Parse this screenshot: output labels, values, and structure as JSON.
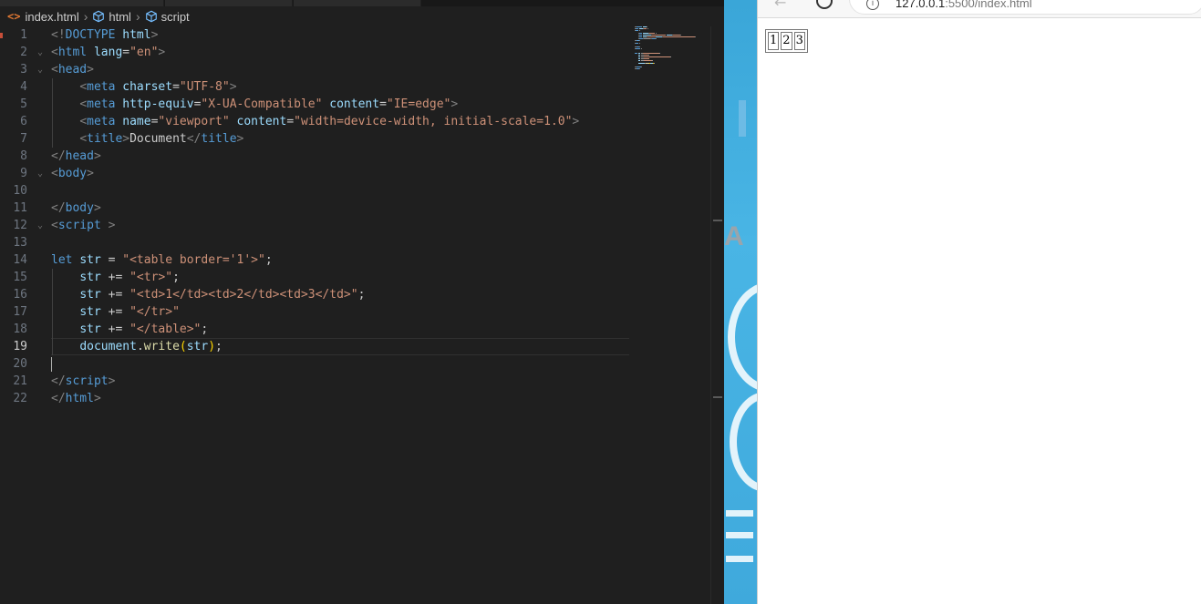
{
  "editor": {
    "breadcrumb": [
      {
        "label": "index.html",
        "icon": "html-file-icon"
      },
      {
        "label": "html",
        "icon": "symbol-element-icon"
      },
      {
        "label": "script",
        "icon": "symbol-element-icon"
      }
    ],
    "line_numbers": [
      "1",
      "2",
      "3",
      "4",
      "5",
      "6",
      "7",
      "8",
      "9",
      "10",
      "11",
      "12",
      "13",
      "14",
      "15",
      "16",
      "17",
      "18",
      "19",
      "20",
      "21",
      "22"
    ],
    "active_line": "19",
    "lines": [
      [
        [
          "p",
          "<!"
        ],
        [
          "t",
          "DOCTYPE"
        ],
        [
          "k",
          " "
        ],
        [
          "a",
          "html"
        ],
        [
          "p",
          ">"
        ]
      ],
      [
        [
          "p",
          "<"
        ],
        [
          "t",
          "html"
        ],
        [
          "k",
          " "
        ],
        [
          "a",
          "lang"
        ],
        [
          "k",
          "="
        ],
        [
          "s",
          "\"en\""
        ],
        [
          "p",
          ">"
        ]
      ],
      [
        [
          "p",
          "<"
        ],
        [
          "t",
          "head"
        ],
        [
          "p",
          ">"
        ]
      ],
      [
        [
          "k",
          "    "
        ],
        [
          "p",
          "<"
        ],
        [
          "t",
          "meta"
        ],
        [
          "k",
          " "
        ],
        [
          "a",
          "charset"
        ],
        [
          "k",
          "="
        ],
        [
          "s",
          "\"UTF-8\""
        ],
        [
          "p",
          ">"
        ]
      ],
      [
        [
          "k",
          "    "
        ],
        [
          "p",
          "<"
        ],
        [
          "t",
          "meta"
        ],
        [
          "k",
          " "
        ],
        [
          "a",
          "http-equiv"
        ],
        [
          "k",
          "="
        ],
        [
          "s",
          "\"X-UA-Compatible\""
        ],
        [
          "k",
          " "
        ],
        [
          "a",
          "content"
        ],
        [
          "k",
          "="
        ],
        [
          "s",
          "\"IE=edge\""
        ],
        [
          "p",
          ">"
        ]
      ],
      [
        [
          "k",
          "    "
        ],
        [
          "p",
          "<"
        ],
        [
          "t",
          "meta"
        ],
        [
          "k",
          " "
        ],
        [
          "a",
          "name"
        ],
        [
          "k",
          "="
        ],
        [
          "s",
          "\"viewport\""
        ],
        [
          "k",
          " "
        ],
        [
          "a",
          "content"
        ],
        [
          "k",
          "="
        ],
        [
          "s",
          "\"width=device-width, initial-scale=1.0\""
        ],
        [
          "p",
          ">"
        ]
      ],
      [
        [
          "k",
          "    "
        ],
        [
          "p",
          "<"
        ],
        [
          "t",
          "title"
        ],
        [
          "p",
          ">"
        ],
        [
          "k",
          "Document"
        ],
        [
          "p",
          "</"
        ],
        [
          "t",
          "title"
        ],
        [
          "p",
          ">"
        ]
      ],
      [
        [
          "p",
          "</"
        ],
        [
          "t",
          "head"
        ],
        [
          "p",
          ">"
        ]
      ],
      [
        [
          "p",
          "<"
        ],
        [
          "t",
          "body"
        ],
        [
          "p",
          ">"
        ]
      ],
      [],
      [
        [
          "p",
          "</"
        ],
        [
          "t",
          "body"
        ],
        [
          "p",
          ">"
        ]
      ],
      [
        [
          "p",
          "<"
        ],
        [
          "t",
          "script"
        ],
        [
          "k",
          " "
        ],
        [
          "p",
          ">"
        ]
      ],
      [],
      [
        [
          "w",
          "let"
        ],
        [
          "k",
          " "
        ],
        [
          "v",
          "str"
        ],
        [
          "k",
          " = "
        ],
        [
          "s",
          "\"<table border='1'>\""
        ],
        [
          "k",
          ";"
        ]
      ],
      [
        [
          "k",
          "    "
        ],
        [
          "v",
          "str"
        ],
        [
          "k",
          " += "
        ],
        [
          "s",
          "\"<tr>\""
        ],
        [
          "k",
          ";"
        ]
      ],
      [
        [
          "k",
          "    "
        ],
        [
          "v",
          "str"
        ],
        [
          "k",
          " += "
        ],
        [
          "s",
          "\"<td>1</td><td>2</td><td>3</td>\""
        ],
        [
          "k",
          ";"
        ]
      ],
      [
        [
          "k",
          "    "
        ],
        [
          "v",
          "str"
        ],
        [
          "k",
          " += "
        ],
        [
          "s",
          "\"</tr>\""
        ]
      ],
      [
        [
          "k",
          "    "
        ],
        [
          "v",
          "str"
        ],
        [
          "k",
          " += "
        ],
        [
          "s",
          "\"</table>\""
        ],
        [
          "k",
          ";"
        ]
      ],
      [
        [
          "k",
          "    "
        ],
        [
          "v",
          "document"
        ],
        [
          "k",
          "."
        ],
        [
          "f",
          "write"
        ],
        [
          "b",
          "("
        ],
        [
          "v",
          "str"
        ],
        [
          "b",
          ")"
        ],
        [
          "k",
          ";"
        ]
      ],
      [],
      [
        [
          "p",
          "</"
        ],
        [
          "t",
          "script"
        ],
        [
          "p",
          ">"
        ]
      ],
      [
        [
          "p",
          "</"
        ],
        [
          "t",
          "html"
        ],
        [
          "p",
          ">"
        ]
      ]
    ],
    "folded_lines": [
      "2",
      "3",
      "9",
      "12"
    ]
  },
  "browser": {
    "url_host": "127.0.0.1",
    "url_rest": ":5500/index.html",
    "info_glyph": "i",
    "rendered_table": {
      "cells": [
        "1",
        "2",
        "3"
      ]
    }
  },
  "desktop": {
    "visible_letter": "A"
  },
  "colors": {
    "editor_bg": "#1f1f1f",
    "tag": "#569cd6",
    "attribute": "#9cdcfe",
    "string": "#ce9178",
    "function": "#dcdcaa",
    "desktop_blue": "#49b5e5"
  }
}
